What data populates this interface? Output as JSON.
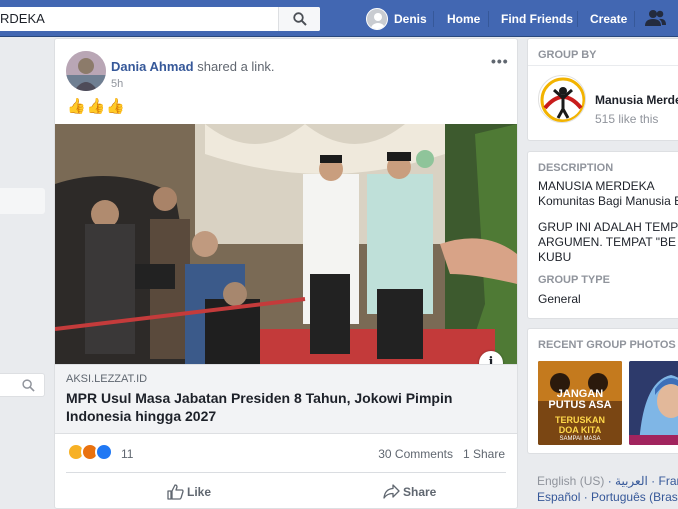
{
  "topbar": {
    "search_value": "RDEKA",
    "user_name": "Denis",
    "nav": [
      "Home",
      "Find Friends",
      "Create"
    ]
  },
  "post": {
    "author": "Dania Ahmad",
    "action": "shared a link.",
    "time": "5h",
    "text": "👍👍👍",
    "link_domain": "AKSI.LEZZAT.ID",
    "link_title": "MPR Usul Masa Jabatan Presiden 8 Tahun, Jokowi Pimpin Indonesia hingga 2027",
    "reaction_count": "11",
    "comments": "30 Comments",
    "shares": "1 Share",
    "like_label": "Like",
    "share_label": "Share"
  },
  "group_by": {
    "heading": "GROUP BY",
    "name": "Manusia Merde",
    "likes": "515 like this"
  },
  "description": {
    "heading": "DESCRIPTION",
    "lines": [
      "MANUSIA MERDEKA",
      "Komunitas Bagi Manusia B",
      "GRUP INI ADALAH TEMP",
      "ARGUMEN. TEMPAT \"BE",
      "KUBU"
    ],
    "type_heading": "GROUP TYPE",
    "type_value": "General"
  },
  "photos": {
    "heading": "RECENT GROUP PHOTOS",
    "photo1_lines": [
      "JANGAN",
      "PUTUS ASA",
      "TERUSKAN",
      "DOA KITA",
      "SAMPAI MASA"
    ]
  },
  "languages": {
    "line1": [
      "English (US)",
      "العربية",
      "Franç"
    ],
    "line2": [
      "Español",
      "Português (Brasi"
    ]
  },
  "colors": {
    "topbar": "#4267b2",
    "link": "#365899",
    "background": "#e9ebee"
  }
}
